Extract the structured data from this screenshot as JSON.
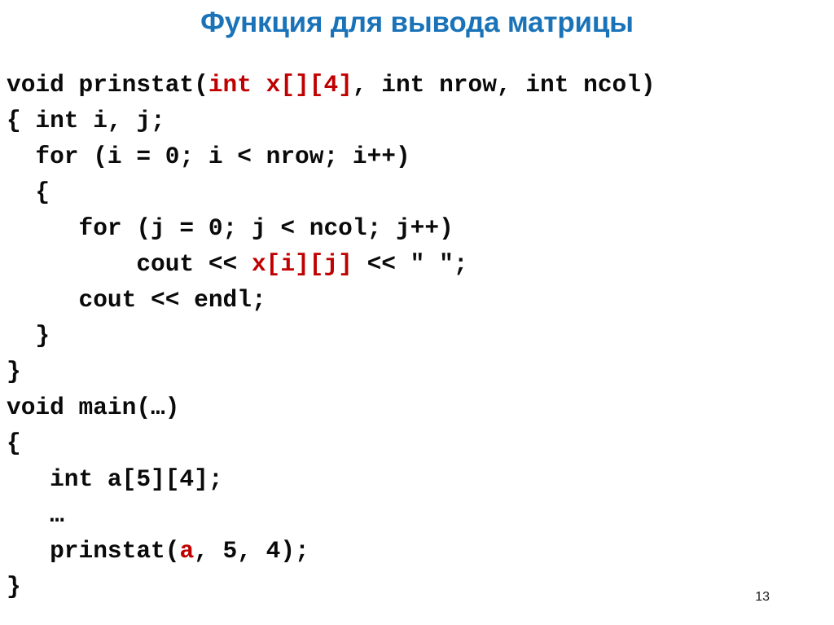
{
  "slide": {
    "title": "Функция для вывода матрицы",
    "title_color": "#1a73b8",
    "background_color": "#ffffff",
    "page_number": "13"
  },
  "code": {
    "text_color": "#0a0a0a",
    "highlight_color": "#c00000",
    "language": "cpp",
    "lines": [
      {
        "id": "l1",
        "plain_pre": "void prinstat(",
        "red": "int x[][4]",
        "plain_post": ", int nrow, int ncol)"
      },
      {
        "id": "l2",
        "plain_pre": "{ int i, j;",
        "red": "",
        "plain_post": ""
      },
      {
        "id": "l3",
        "plain_pre": "  for (i = 0; i < nrow; i++)",
        "red": "",
        "plain_post": ""
      },
      {
        "id": "l4",
        "plain_pre": "  {",
        "red": "",
        "plain_post": ""
      },
      {
        "id": "l5",
        "plain_pre": "     for (j = 0; j < ncol; j++)",
        "red": "",
        "plain_post": ""
      },
      {
        "id": "l6",
        "plain_pre": "         cout << ",
        "red": "x[i][j]",
        "plain_post": " << \" \";"
      },
      {
        "id": "l7",
        "plain_pre": "     cout << endl;",
        "red": "",
        "plain_post": ""
      },
      {
        "id": "l8",
        "plain_pre": "  }",
        "red": "",
        "plain_post": ""
      },
      {
        "id": "l9",
        "plain_pre": "}",
        "red": "",
        "plain_post": ""
      },
      {
        "id": "l10",
        "plain_pre": "void main(…)",
        "red": "",
        "plain_post": ""
      },
      {
        "id": "l11",
        "plain_pre": "{",
        "red": "",
        "plain_post": ""
      },
      {
        "id": "l12",
        "plain_pre": "   int a[5][4];",
        "red": "",
        "plain_post": ""
      },
      {
        "id": "l13",
        "plain_pre": "   …",
        "red": "",
        "plain_post": ""
      },
      {
        "id": "l14",
        "plain_pre": "   prinstat(",
        "red": "a",
        "plain_post": ", 5, 4);"
      },
      {
        "id": "l15",
        "plain_pre": "}",
        "red": "",
        "plain_post": ""
      }
    ]
  }
}
